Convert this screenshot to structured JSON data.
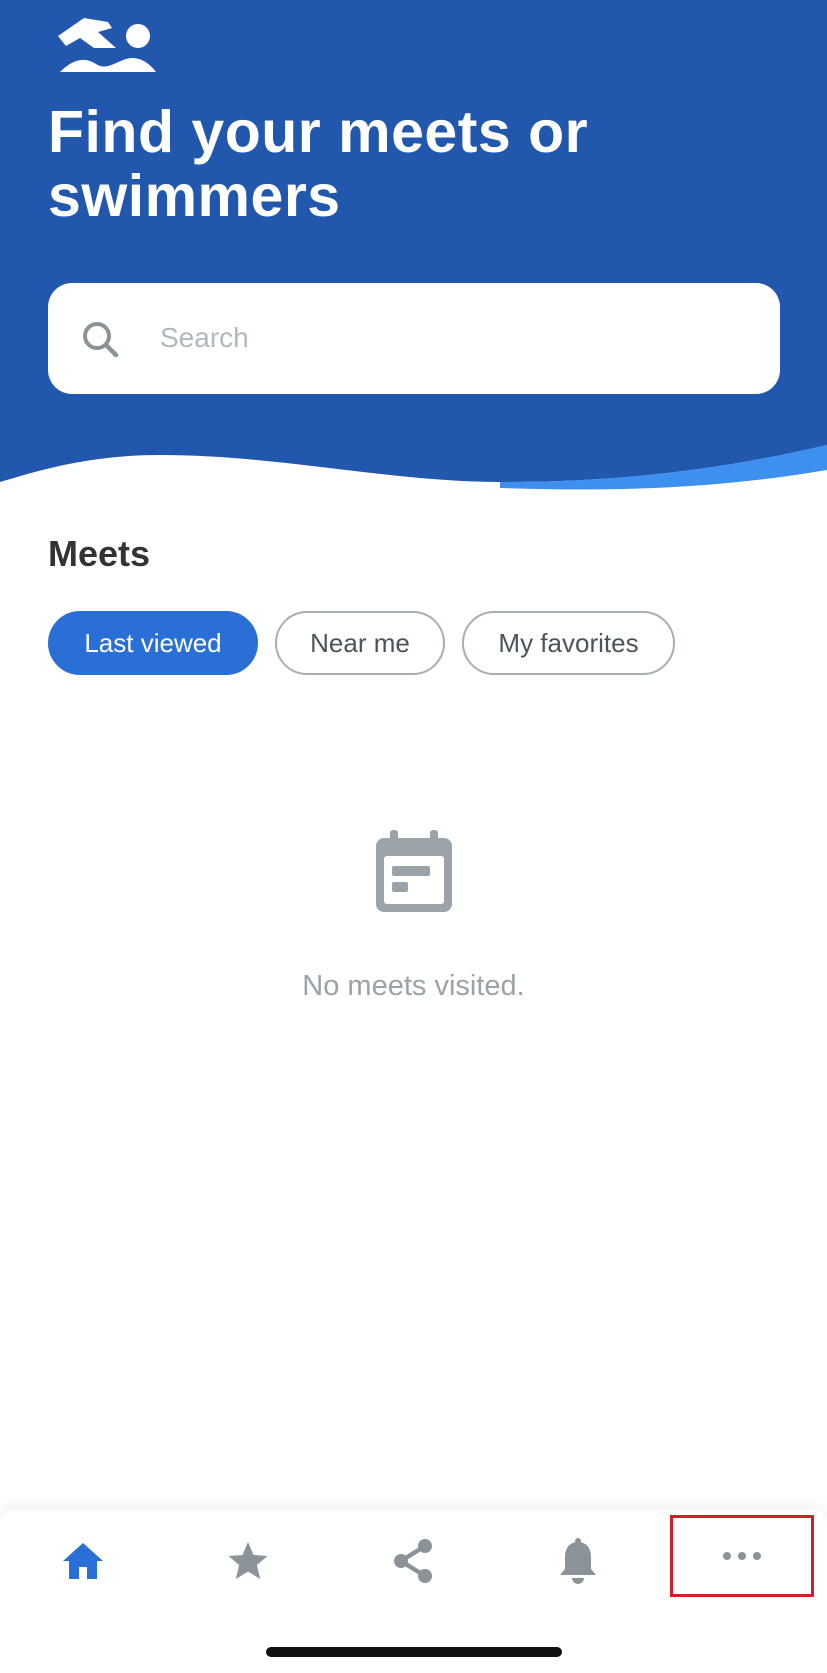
{
  "app": {
    "colors": {
      "primary": "#2158ad",
      "accent": "#2a6fd6",
      "wave_highlight": "#3d8ff0",
      "muted": "#9aa3aa",
      "highlight_box": "#d21f2a"
    },
    "logo_icon": "swimmer-logo-icon"
  },
  "header": {
    "title": "Find your meets or swimmers"
  },
  "search": {
    "placeholder": "Search",
    "value": "",
    "icon": "search-icon"
  },
  "meets": {
    "title": "Meets",
    "filters": [
      {
        "label": "Last viewed",
        "selected": true
      },
      {
        "label": "Near me",
        "selected": false
      },
      {
        "label": "My favorites",
        "selected": false
      }
    ],
    "empty_state": {
      "icon": "calendar-icon",
      "message": "No meets visited."
    }
  },
  "bottom_nav": {
    "items": [
      {
        "icon": "home-icon",
        "active": true
      },
      {
        "icon": "star-icon",
        "active": false
      },
      {
        "icon": "share-icon",
        "active": false
      },
      {
        "icon": "bell-icon",
        "active": false
      },
      {
        "icon": "more-icon",
        "active": false,
        "highlighted": true
      }
    ]
  }
}
